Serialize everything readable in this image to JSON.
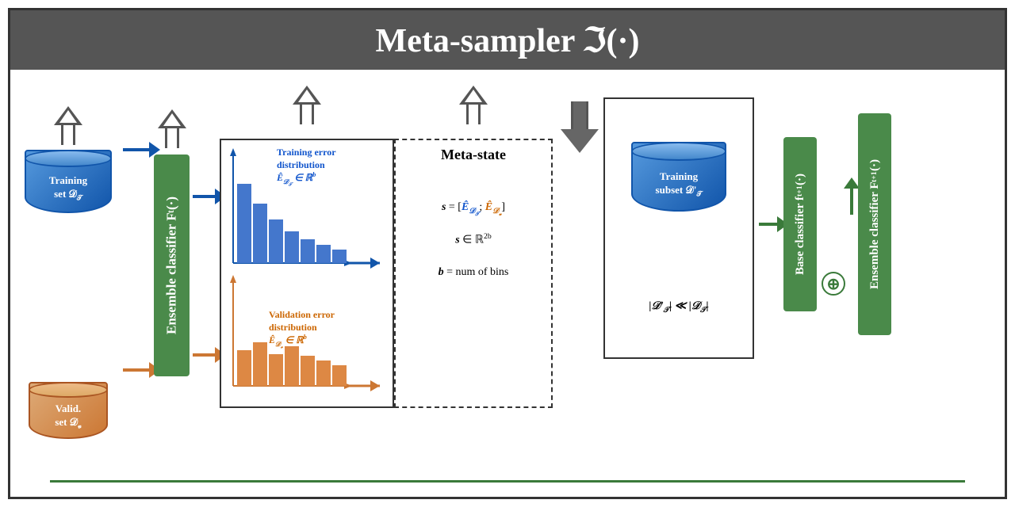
{
  "header": {
    "title": "Meta-sampler ℑ(·)"
  },
  "training_set": {
    "label": "Training\nset 𝒟_𝒯"
  },
  "valid_set": {
    "label": "Valid.\nset 𝒟_𝓋"
  },
  "ensemble_classifier_left": {
    "label": "Ensemble classifier F_t(·)"
  },
  "histogram": {
    "training_error_label": "Training error\ndistribution",
    "training_error_formula": "Ê_{𝒟_𝒯} ∈ ℝ^b",
    "validation_error_label": "Validation error\ndistribution",
    "validation_error_formula": "Ê_{𝒟_𝓋} ∈ ℝ^b"
  },
  "meta_state": {
    "title": "Meta-state",
    "formula_s": "s = [Ê_{𝒟_𝒯}; Ê_{𝒟_𝓋}]",
    "formula_s2": "s ∈ ℝ^{2b}",
    "formula_b": "b = num of bins"
  },
  "training_subset": {
    "label": "Training\nsubset 𝒟'_𝒯",
    "size_label": "|𝒟'_𝒯| ≪ |𝒟_𝒯|"
  },
  "base_classifier": {
    "label": "Base classifier f_{t+1}(·)"
  },
  "ensemble_classifier_right": {
    "label": "Ensemble classifier F_{t+1}(·)"
  }
}
